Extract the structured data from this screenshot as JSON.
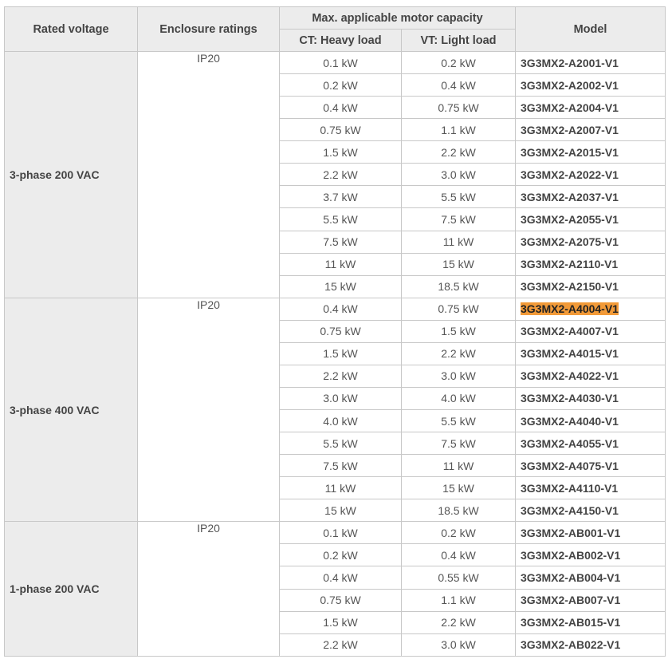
{
  "headers": {
    "rated_voltage": "Rated voltage",
    "enclosure_ratings": "Enclosure ratings",
    "max_capacity": "Max. applicable motor capacity",
    "ct": "CT: Heavy load",
    "vt": "VT: Light load",
    "model": "Model"
  },
  "highlight_color": "#f29a38",
  "groups": [
    {
      "voltage": "3-phase 200 VAC",
      "enclosure": "IP20",
      "rows": [
        {
          "ct": "0.1 kW",
          "vt": "0.2 kW",
          "model": "3G3MX2-A2001-V1"
        },
        {
          "ct": "0.2 kW",
          "vt": "0.4 kW",
          "model": "3G3MX2-A2002-V1"
        },
        {
          "ct": "0.4 kW",
          "vt": "0.75 kW",
          "model": "3G3MX2-A2004-V1"
        },
        {
          "ct": "0.75 kW",
          "vt": "1.1 kW",
          "model": "3G3MX2-A2007-V1"
        },
        {
          "ct": "1.5 kW",
          "vt": "2.2 kW",
          "model": "3G3MX2-A2015-V1"
        },
        {
          "ct": "2.2 kW",
          "vt": "3.0 kW",
          "model": "3G3MX2-A2022-V1"
        },
        {
          "ct": "3.7 kW",
          "vt": "5.5 kW",
          "model": "3G3MX2-A2037-V1"
        },
        {
          "ct": "5.5 kW",
          "vt": "7.5 kW",
          "model": "3G3MX2-A2055-V1"
        },
        {
          "ct": "7.5 kW",
          "vt": "11 kW",
          "model": "3G3MX2-A2075-V1"
        },
        {
          "ct": "11 kW",
          "vt": "15 kW",
          "model": "3G3MX2-A2110-V1"
        },
        {
          "ct": "15 kW",
          "vt": "18.5 kW",
          "model": "3G3MX2-A2150-V1"
        }
      ]
    },
    {
      "voltage": "3-phase 400 VAC",
      "enclosure": "IP20",
      "rows": [
        {
          "ct": "0.4 kW",
          "vt": "0.75 kW",
          "model": "3G3MX2-A4004-V1",
          "highlight": true
        },
        {
          "ct": "0.75 kW",
          "vt": "1.5 kW",
          "model": "3G3MX2-A4007-V1"
        },
        {
          "ct": "1.5 kW",
          "vt": "2.2 kW",
          "model": "3G3MX2-A4015-V1"
        },
        {
          "ct": "2.2 kW",
          "vt": "3.0 kW",
          "model": "3G3MX2-A4022-V1"
        },
        {
          "ct": "3.0 kW",
          "vt": "4.0 kW",
          "model": "3G3MX2-A4030-V1"
        },
        {
          "ct": "4.0 kW",
          "vt": "5.5 kW",
          "model": "3G3MX2-A4040-V1"
        },
        {
          "ct": "5.5 kW",
          "vt": "7.5 kW",
          "model": "3G3MX2-A4055-V1"
        },
        {
          "ct": "7.5 kW",
          "vt": "11 kW",
          "model": "3G3MX2-A4075-V1"
        },
        {
          "ct": "11 kW",
          "vt": "15 kW",
          "model": "3G3MX2-A4110-V1"
        },
        {
          "ct": "15 kW",
          "vt": "18.5 kW",
          "model": "3G3MX2-A4150-V1"
        }
      ]
    },
    {
      "voltage": "1-phase 200 VAC",
      "enclosure": "IP20",
      "rows": [
        {
          "ct": "0.1 kW",
          "vt": "0.2 kW",
          "model": "3G3MX2-AB001-V1"
        },
        {
          "ct": "0.2 kW",
          "vt": "0.4 kW",
          "model": "3G3MX2-AB002-V1"
        },
        {
          "ct": "0.4 kW",
          "vt": "0.55 kW",
          "model": "3G3MX2-AB004-V1"
        },
        {
          "ct": "0.75 kW",
          "vt": "1.1 kW",
          "model": "3G3MX2-AB007-V1"
        },
        {
          "ct": "1.5 kW",
          "vt": "2.2 kW",
          "model": "3G3MX2-AB015-V1"
        },
        {
          "ct": "2.2 kW",
          "vt": "3.0 kW",
          "model": "3G3MX2-AB022-V1"
        }
      ]
    }
  ]
}
